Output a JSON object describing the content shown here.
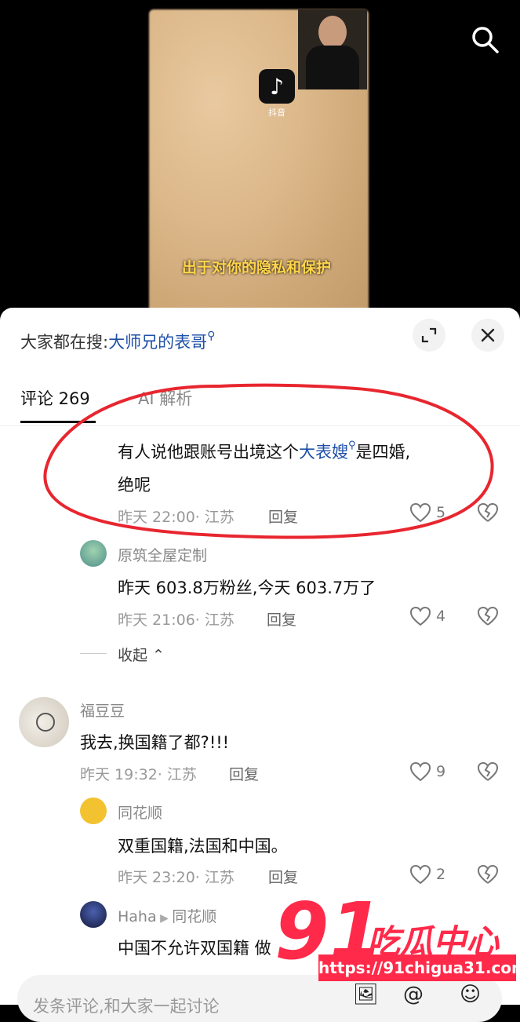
{
  "video": {
    "app_caption": "抖音",
    "subtitle": "出于对你的隐私和保护"
  },
  "sheet": {
    "hot_prefix": "大家都在搜:",
    "hot_keyword": "大师兄的表哥",
    "tabs": [
      {
        "label": "评论 269"
      },
      {
        "label": "AI 解析"
      }
    ]
  },
  "comments": [
    {
      "text_pre": "有人说他跟账号出境这个",
      "text_kw": "大表嫂",
      "text_post": "是四婚,",
      "text_line2": "绝呢",
      "meta": "昨天 22:00· 江苏",
      "reply": "回复",
      "likes": "5"
    },
    {
      "name": "原筑全屋定制",
      "text": "昨天 603.8万粉丝,今天 603.7万了",
      "meta": "昨天 21:06· 江苏",
      "reply": "回复",
      "likes": "4"
    },
    {
      "collapse": "收起"
    },
    {
      "name": "福豆豆",
      "text": "我去,换国籍了都?!!!",
      "meta": "昨天 19:32· 江苏",
      "reply": "回复",
      "likes": "9"
    },
    {
      "name": "同花顺",
      "text": "双重国籍,法国和中国。",
      "meta": "昨天 23:20· 江苏",
      "reply": "回复",
      "likes": "2"
    },
    {
      "name": "Haha",
      "reply_to": "同花顺",
      "text": "中国不允许双国籍 做"
    }
  ],
  "footer": {
    "placeholder": "发条评论,和大家一起讨论"
  },
  "watermark": {
    "number": "91",
    "name": "吃瓜中心",
    "url": "https://91chigua31.com"
  }
}
